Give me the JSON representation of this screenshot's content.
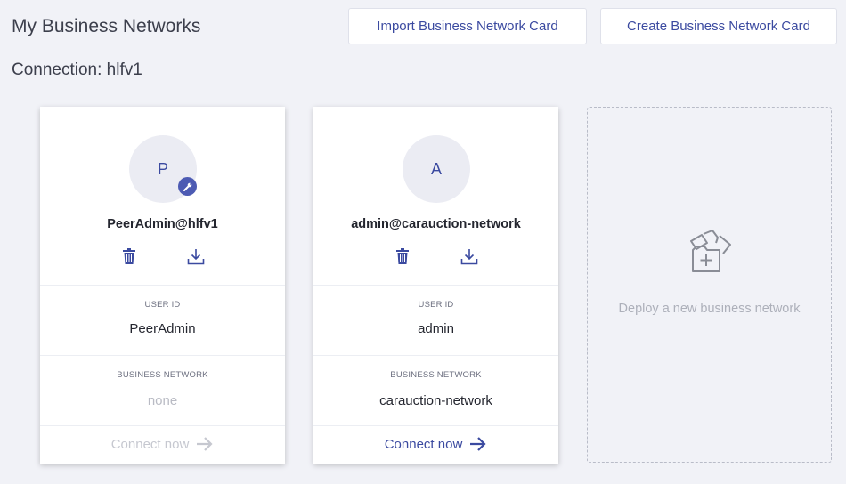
{
  "header": {
    "title": "My Business Networks",
    "import_label": "Import Business Network Card",
    "create_label": "Create Business Network Card"
  },
  "connection": {
    "label": "Connection: hlfv1"
  },
  "cards": [
    {
      "avatar_letter": "P",
      "name": "PeerAdmin@hlfv1",
      "user_id_label": "USER ID",
      "user_id": "PeerAdmin",
      "network_label": "BUSINESS NETWORK",
      "network": "none",
      "connect_label": "Connect now",
      "connect_enabled": false,
      "has_badge": true
    },
    {
      "avatar_letter": "A",
      "name": "admin@carauction-network",
      "user_id_label": "USER ID",
      "user_id": "admin",
      "network_label": "BUSINESS NETWORK",
      "network": "carauction-network",
      "connect_label": "Connect now",
      "connect_enabled": true,
      "has_badge": false
    }
  ],
  "deploy": {
    "label": "Deploy a new business network"
  },
  "colors": {
    "accent": "#3b4aa0",
    "badge": "#4d5bb3",
    "background": "#f1f2f7",
    "disabled": "#c6c8d0"
  },
  "icons": [
    "wrench-icon",
    "trash-icon",
    "download-icon",
    "arrow-right-icon",
    "deploy-network-icon"
  ]
}
